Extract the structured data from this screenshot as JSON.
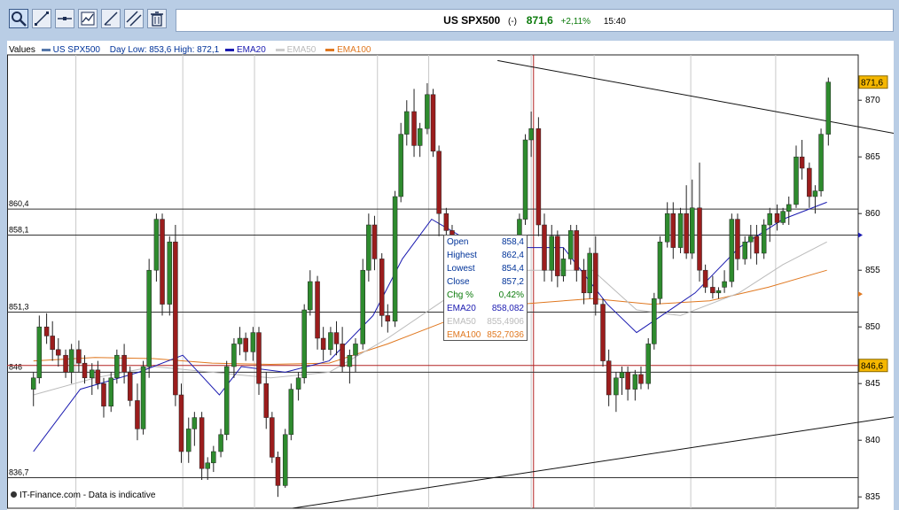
{
  "toolbar": {
    "icons": [
      "zoom-icon",
      "draw-line-icon",
      "horizontal-line-icon",
      "indicators-icon",
      "trend-line-icon",
      "parallel-lines-icon",
      "delete-icon"
    ]
  },
  "header": {
    "name": "US SPX500",
    "paren": "(-)",
    "price": "871,6",
    "change": "+2,11%",
    "time": "15:40",
    "price_color": "#0a7a0a"
  },
  "legend": {
    "values_label": "Values",
    "instrument": "US SPX500",
    "day_range": "Day Low: 853,6 High: 872,1",
    "ema20": "EMA20",
    "ema50": "EMA50",
    "ema100": "EMA100"
  },
  "info": {
    "open_label": "Open",
    "open": "858,4",
    "high_label": "Highest",
    "high": "862,4",
    "low_label": "Lowest",
    "low": "854,4",
    "close_label": "Close",
    "close": "857,2",
    "chg_label": "Chg %",
    "chg": "0,42%",
    "ema20_label": "EMA20",
    "ema20": "858,082",
    "ema50_label": "EMA50",
    "ema50": "855,4906",
    "ema100_label": "EMA100",
    "ema100": "852,7036"
  },
  "footer": "IT-Finance.com - Data is indicative",
  "chart_data": {
    "type": "candlestick",
    "ylim": [
      834,
      874
    ],
    "y_ticks": [
      835,
      840,
      845,
      850,
      855,
      860,
      865,
      870
    ],
    "levels": [
      {
        "value": 860.4,
        "label": "860,4"
      },
      {
        "value": 858.1,
        "label": "858,1"
      },
      {
        "value": 851.3,
        "label": "851,3"
      },
      {
        "value": 846,
        "label": "846"
      },
      {
        "value": 836.7,
        "label": "836,7"
      }
    ],
    "last_price": {
      "value": 871.6,
      "label": "871,6"
    },
    "ref_price": {
      "value": 846.6,
      "label": "846,6"
    },
    "trendlines": [
      {
        "x": [
          0.335,
          0.985
        ],
        "y": [
          873.5,
          858.1
        ]
      },
      {
        "x": [
          0.195,
          0.985
        ],
        "y": [
          834,
          849.5
        ]
      }
    ],
    "colors": {
      "up": "#2e8b2e",
      "down": "#9b1d1d",
      "ema20": "#1a1ab0",
      "ema50": "#bbbbbb",
      "ema100": "#e07820",
      "instrument": "#003399"
    },
    "candles": [
      {
        "x": 0.018,
        "o": 844.5,
        "h": 846,
        "l": 843,
        "c": 845.5
      },
      {
        "x": 0.022,
        "o": 845.5,
        "h": 851,
        "l": 845,
        "c": 850
      },
      {
        "x": 0.027,
        "o": 850,
        "h": 851.2,
        "l": 848.5,
        "c": 849.2
      },
      {
        "x": 0.031,
        "o": 849.2,
        "h": 850.5,
        "l": 847,
        "c": 848
      },
      {
        "x": 0.035,
        "o": 848,
        "h": 849,
        "l": 846.5,
        "c": 847.5
      },
      {
        "x": 0.04,
        "o": 847.5,
        "h": 848,
        "l": 845.5,
        "c": 846
      },
      {
        "x": 0.044,
        "o": 846,
        "h": 848.5,
        "l": 845,
        "c": 848
      },
      {
        "x": 0.049,
        "o": 848,
        "h": 848.8,
        "l": 846,
        "c": 846.8
      },
      {
        "x": 0.053,
        "o": 846.8,
        "h": 847.5,
        "l": 845,
        "c": 845.5
      },
      {
        "x": 0.058,
        "o": 845.5,
        "h": 846.8,
        "l": 844,
        "c": 846.2
      },
      {
        "x": 0.062,
        "o": 846.2,
        "h": 847,
        "l": 844.5,
        "c": 845
      },
      {
        "x": 0.066,
        "o": 845,
        "h": 845.5,
        "l": 842,
        "c": 843
      },
      {
        "x": 0.071,
        "o": 843,
        "h": 846,
        "l": 842.5,
        "c": 845.5
      },
      {
        "x": 0.075,
        "o": 845.5,
        "h": 848,
        "l": 845,
        "c": 847.5
      },
      {
        "x": 0.08,
        "o": 847.5,
        "h": 848.5,
        "l": 845,
        "c": 846
      },
      {
        "x": 0.084,
        "o": 846,
        "h": 846.5,
        "l": 843,
        "c": 843.5
      },
      {
        "x": 0.089,
        "o": 843.5,
        "h": 845,
        "l": 840,
        "c": 841
      },
      {
        "x": 0.093,
        "o": 841,
        "h": 847,
        "l": 840.5,
        "c": 846.5
      },
      {
        "x": 0.097,
        "o": 846.5,
        "h": 856,
        "l": 845.5,
        "c": 855
      },
      {
        "x": 0.102,
        "o": 855,
        "h": 860,
        "l": 854,
        "c": 859.5
      },
      {
        "x": 0.106,
        "o": 859.5,
        "h": 860,
        "l": 851,
        "c": 852
      },
      {
        "x": 0.111,
        "o": 852,
        "h": 858,
        "l": 851,
        "c": 857.5
      },
      {
        "x": 0.115,
        "o": 857.5,
        "h": 859,
        "l": 843,
        "c": 844
      },
      {
        "x": 0.119,
        "o": 844,
        "h": 845,
        "l": 838,
        "c": 839
      },
      {
        "x": 0.124,
        "o": 839,
        "h": 842,
        "l": 838,
        "c": 841
      },
      {
        "x": 0.128,
        "o": 841,
        "h": 842.5,
        "l": 839.5,
        "c": 842
      },
      {
        "x": 0.133,
        "o": 842,
        "h": 842.5,
        "l": 836.5,
        "c": 837.5
      },
      {
        "x": 0.137,
        "o": 837.5,
        "h": 838.5,
        "l": 836.5,
        "c": 838
      },
      {
        "x": 0.141,
        "o": 838,
        "h": 839.5,
        "l": 837.2,
        "c": 839
      },
      {
        "x": 0.146,
        "o": 839,
        "h": 841,
        "l": 838.5,
        "c": 840.5
      },
      {
        "x": 0.15,
        "o": 840.5,
        "h": 847,
        "l": 840,
        "c": 846.5
      },
      {
        "x": 0.155,
        "o": 846.5,
        "h": 849,
        "l": 845.5,
        "c": 848.5
      },
      {
        "x": 0.159,
        "o": 848.5,
        "h": 850,
        "l": 847.5,
        "c": 849
      },
      {
        "x": 0.163,
        "o": 849,
        "h": 849.5,
        "l": 847,
        "c": 847.8
      },
      {
        "x": 0.168,
        "o": 847.8,
        "h": 850,
        "l": 847,
        "c": 849.5
      },
      {
        "x": 0.172,
        "o": 849.5,
        "h": 850,
        "l": 844,
        "c": 845
      },
      {
        "x": 0.177,
        "o": 845,
        "h": 846,
        "l": 841,
        "c": 842
      },
      {
        "x": 0.181,
        "o": 842,
        "h": 842.5,
        "l": 838,
        "c": 838.5
      },
      {
        "x": 0.185,
        "o": 838.5,
        "h": 839,
        "l": 835,
        "c": 836
      },
      {
        "x": 0.19,
        "o": 836,
        "h": 841,
        "l": 835.8,
        "c": 840.5
      },
      {
        "x": 0.194,
        "o": 840.5,
        "h": 845,
        "l": 840,
        "c": 844.5
      },
      {
        "x": 0.199,
        "o": 844.5,
        "h": 846,
        "l": 843.5,
        "c": 845.5
      },
      {
        "x": 0.203,
        "o": 845.5,
        "h": 852,
        "l": 845,
        "c": 851.5
      },
      {
        "x": 0.207,
        "o": 851.5,
        "h": 855,
        "l": 851,
        "c": 854
      },
      {
        "x": 0.212,
        "o": 854,
        "h": 854.5,
        "l": 848,
        "c": 849
      },
      {
        "x": 0.216,
        "o": 849,
        "h": 850,
        "l": 847,
        "c": 848
      },
      {
        "x": 0.221,
        "o": 848,
        "h": 850,
        "l": 847.5,
        "c": 849.5
      },
      {
        "x": 0.225,
        "o": 849.5,
        "h": 850.5,
        "l": 847.5,
        "c": 848.5
      },
      {
        "x": 0.229,
        "o": 848.5,
        "h": 850,
        "l": 846,
        "c": 846.5
      },
      {
        "x": 0.234,
        "o": 846.5,
        "h": 848,
        "l": 845,
        "c": 847.5
      },
      {
        "x": 0.238,
        "o": 847.5,
        "h": 849,
        "l": 846,
        "c": 848.5
      },
      {
        "x": 0.243,
        "o": 848.5,
        "h": 856,
        "l": 848,
        "c": 855
      },
      {
        "x": 0.247,
        "o": 855,
        "h": 860,
        "l": 854,
        "c": 859
      },
      {
        "x": 0.251,
        "o": 859,
        "h": 859.8,
        "l": 855,
        "c": 856
      },
      {
        "x": 0.256,
        "o": 856,
        "h": 856.5,
        "l": 850,
        "c": 851
      },
      {
        "x": 0.26,
        "o": 851,
        "h": 852,
        "l": 849.5,
        "c": 850.5
      },
      {
        "x": 0.265,
        "o": 850.5,
        "h": 862,
        "l": 850,
        "c": 861.5
      },
      {
        "x": 0.269,
        "o": 861.5,
        "h": 868,
        "l": 861,
        "c": 867
      },
      {
        "x": 0.273,
        "o": 867,
        "h": 870,
        "l": 866,
        "c": 869
      },
      {
        "x": 0.278,
        "o": 869,
        "h": 871,
        "l": 865,
        "c": 866
      },
      {
        "x": 0.282,
        "o": 866,
        "h": 868,
        "l": 865,
        "c": 867.5
      },
      {
        "x": 0.287,
        "o": 867.5,
        "h": 871.5,
        "l": 867,
        "c": 870.5
      },
      {
        "x": 0.291,
        "o": 870.5,
        "h": 871,
        "l": 865,
        "c": 865.5
      },
      {
        "x": 0.295,
        "o": 865.5,
        "h": 866,
        "l": 858,
        "c": 860
      },
      {
        "x": 0.3,
        "o": 860,
        "h": 860.5,
        "l": 857,
        "c": 858.5
      },
      {
        "x": 0.304,
        "o": 858.5,
        "h": 859,
        "l": 857,
        "c": 857.5
      },
      {
        "x": 0.309,
        "o": 857.5,
        "h": 858,
        "l": 856.5,
        "c": 857
      },
      {
        "x": 0.35,
        "o": 855,
        "h": 860,
        "l": 854.5,
        "c": 859.5
      },
      {
        "x": 0.354,
        "o": 859.5,
        "h": 867,
        "l": 859,
        "c": 866.5
      },
      {
        "x": 0.358,
        "o": 866.5,
        "h": 869,
        "l": 865,
        "c": 867.5
      },
      {
        "x": 0.363,
        "o": 867.5,
        "h": 868.5,
        "l": 858,
        "c": 859
      },
      {
        "x": 0.367,
        "o": 859,
        "h": 860,
        "l": 854,
        "c": 855
      },
      {
        "x": 0.372,
        "o": 855,
        "h": 859,
        "l": 854,
        "c": 858
      },
      {
        "x": 0.376,
        "o": 858,
        "h": 858.5,
        "l": 853.5,
        "c": 854.5
      },
      {
        "x": 0.38,
        "o": 854.5,
        "h": 857,
        "l": 854,
        "c": 856
      },
      {
        "x": 0.385,
        "o": 856,
        "h": 859,
        "l": 855.5,
        "c": 858.5
      },
      {
        "x": 0.389,
        "o": 858.5,
        "h": 859,
        "l": 854,
        "c": 855
      },
      {
        "x": 0.394,
        "o": 855,
        "h": 856,
        "l": 852,
        "c": 853
      },
      {
        "x": 0.398,
        "o": 853,
        "h": 857,
        "l": 852.5,
        "c": 856.5
      },
      {
        "x": 0.402,
        "o": 856.5,
        "h": 858,
        "l": 851,
        "c": 852
      },
      {
        "x": 0.407,
        "o": 852,
        "h": 852.5,
        "l": 846.5,
        "c": 847
      },
      {
        "x": 0.411,
        "o": 847,
        "h": 848,
        "l": 843,
        "c": 844
      },
      {
        "x": 0.416,
        "o": 844,
        "h": 846,
        "l": 842.5,
        "c": 845.5
      },
      {
        "x": 0.42,
        "o": 845.5,
        "h": 846.5,
        "l": 844,
        "c": 846
      },
      {
        "x": 0.424,
        "o": 846,
        "h": 846.5,
        "l": 843.5,
        "c": 844.5
      },
      {
        "x": 0.429,
        "o": 844.5,
        "h": 846.2,
        "l": 843.5,
        "c": 845.8
      },
      {
        "x": 0.433,
        "o": 845.8,
        "h": 846.5,
        "l": 844.5,
        "c": 845
      },
      {
        "x": 0.438,
        "o": 845,
        "h": 849,
        "l": 844.5,
        "c": 848.5
      },
      {
        "x": 0.442,
        "o": 848.5,
        "h": 853,
        "l": 848,
        "c": 852.5
      },
      {
        "x": 0.446,
        "o": 852.5,
        "h": 858,
        "l": 852,
        "c": 857.5
      },
      {
        "x": 0.451,
        "o": 857.5,
        "h": 861,
        "l": 857,
        "c": 860
      },
      {
        "x": 0.455,
        "o": 860,
        "h": 861,
        "l": 856,
        "c": 857
      },
      {
        "x": 0.46,
        "o": 857,
        "h": 860.5,
        "l": 856.5,
        "c": 860
      },
      {
        "x": 0.464,
        "o": 860,
        "h": 862.5,
        "l": 856,
        "c": 856.5
      },
      {
        "x": 0.468,
        "o": 856.5,
        "h": 863,
        "l": 856,
        "c": 860.5
      },
      {
        "x": 0.473,
        "o": 860.5,
        "h": 864.5,
        "l": 854,
        "c": 855
      },
      {
        "x": 0.477,
        "o": 855,
        "h": 855.5,
        "l": 853,
        "c": 853.5
      },
      {
        "x": 0.482,
        "o": 853.5,
        "h": 854.5,
        "l": 852.5,
        "c": 853
      },
      {
        "x": 0.486,
        "o": 853,
        "h": 853.5,
        "l": 852.5,
        "c": 853.2
      },
      {
        "x": 0.49,
        "o": 853.5,
        "h": 855,
        "l": 853,
        "c": 854
      },
      {
        "x": 0.495,
        "o": 854,
        "h": 860,
        "l": 853.5,
        "c": 859.5
      },
      {
        "x": 0.499,
        "o": 859.5,
        "h": 860,
        "l": 855,
        "c": 856
      },
      {
        "x": 0.504,
        "o": 856,
        "h": 858,
        "l": 855.5,
        "c": 857.5
      },
      {
        "x": 0.508,
        "o": 857.5,
        "h": 859,
        "l": 856,
        "c": 858
      },
      {
        "x": 0.512,
        "o": 858,
        "h": 859,
        "l": 855.5,
        "c": 856.5
      },
      {
        "x": 0.517,
        "o": 856.5,
        "h": 859.5,
        "l": 856,
        "c": 859
      },
      {
        "x": 0.521,
        "o": 859,
        "h": 860.5,
        "l": 857.5,
        "c": 860
      },
      {
        "x": 0.526,
        "o": 860,
        "h": 860.8,
        "l": 858.5,
        "c": 859.2
      },
      {
        "x": 0.53,
        "o": 859.2,
        "h": 860.5,
        "l": 859,
        "c": 860.2
      },
      {
        "x": 0.534,
        "o": 860.2,
        "h": 861.5,
        "l": 859,
        "c": 860.8
      },
      {
        "x": 0.539,
        "o": 860.8,
        "h": 866,
        "l": 860.5,
        "c": 865
      },
      {
        "x": 0.543,
        "o": 865,
        "h": 866.5,
        "l": 863,
        "c": 864
      },
      {
        "x": 0.548,
        "o": 864,
        "h": 864.5,
        "l": 860.5,
        "c": 861.5
      },
      {
        "x": 0.552,
        "o": 861.5,
        "h": 862.5,
        "l": 860,
        "c": 862
      },
      {
        "x": 0.556,
        "o": 862,
        "h": 867.5,
        "l": 861.5,
        "c": 867
      },
      {
        "x": 0.561,
        "o": 867,
        "h": 872,
        "l": 866,
        "c": 871.6
      }
    ],
    "ema20": [
      [
        0.018,
        839
      ],
      [
        0.05,
        844.5
      ],
      [
        0.09,
        846
      ],
      [
        0.12,
        847.5
      ],
      [
        0.145,
        844
      ],
      [
        0.16,
        846.5
      ],
      [
        0.19,
        846
      ],
      [
        0.22,
        847
      ],
      [
        0.25,
        851
      ],
      [
        0.27,
        856
      ],
      [
        0.29,
        859.5
      ],
      [
        0.31,
        858
      ],
      [
        0.35,
        857
      ],
      [
        0.38,
        857
      ],
      [
        0.41,
        852
      ],
      [
        0.43,
        849.5
      ],
      [
        0.47,
        853
      ],
      [
        0.5,
        857
      ],
      [
        0.53,
        859.5
      ],
      [
        0.56,
        861
      ]
    ],
    "ema50": [
      [
        0.018,
        844
      ],
      [
        0.06,
        845.5
      ],
      [
        0.1,
        846.5
      ],
      [
        0.14,
        846
      ],
      [
        0.18,
        845.5
      ],
      [
        0.22,
        846
      ],
      [
        0.26,
        849
      ],
      [
        0.3,
        852.5
      ],
      [
        0.35,
        855
      ],
      [
        0.4,
        855
      ],
      [
        0.43,
        851.5
      ],
      [
        0.46,
        851
      ],
      [
        0.5,
        853
      ],
      [
        0.53,
        855.5
      ],
      [
        0.56,
        857.5
      ]
    ],
    "ema100": [
      [
        0.018,
        847
      ],
      [
        0.06,
        847.3
      ],
      [
        0.1,
        847.2
      ],
      [
        0.14,
        846.8
      ],
      [
        0.18,
        846.7
      ],
      [
        0.22,
        846.8
      ],
      [
        0.26,
        848.5
      ],
      [
        0.3,
        850.5
      ],
      [
        0.35,
        852
      ],
      [
        0.4,
        852.5
      ],
      [
        0.44,
        852
      ],
      [
        0.48,
        852.3
      ],
      [
        0.52,
        853.5
      ],
      [
        0.56,
        855
      ]
    ]
  }
}
